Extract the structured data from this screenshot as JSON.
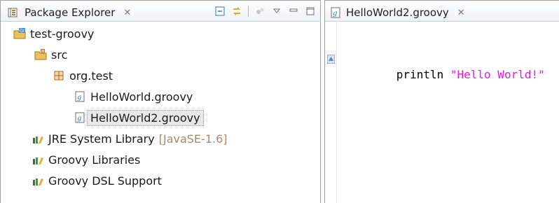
{
  "package_explorer": {
    "tab_title": "Package Explorer",
    "close_glyph": "✕",
    "toolbar": {
      "icons": [
        "collapse-all-icon",
        "link-with-editor-icon",
        "focus-icon",
        "view-menu-icon",
        "minimize-icon",
        "maximize-icon"
      ]
    },
    "tree": [
      {
        "label": "test-groovy",
        "icon": "groovy-project-icon",
        "level": 0
      },
      {
        "label": "src",
        "icon": "source-folder-icon",
        "level": 1
      },
      {
        "label": "org.test",
        "icon": "package-icon",
        "level": 2
      },
      {
        "label": "HelloWorld.groovy",
        "icon": "groovy-file-icon",
        "level": 3
      },
      {
        "label": "HelloWorld2.groovy",
        "icon": "groovy-file-icon",
        "level": 3,
        "selected": true
      },
      {
        "label": "JRE System Library",
        "decoration": "[JavaSE-1.6]",
        "icon": "library-icon",
        "level": 1
      },
      {
        "label": "Groovy Libraries",
        "icon": "library-icon",
        "level": 1
      },
      {
        "label": "Groovy DSL Support",
        "icon": "library-icon",
        "level": 1
      }
    ]
  },
  "editor": {
    "tab_title": "HelloWorld2.groovy",
    "close_glyph": "✕",
    "code": {
      "keyword": "println",
      "string": "\"Hello World!\""
    }
  },
  "colors": {
    "string": "#e01be0",
    "decoration": "#a8876a",
    "library": "#2f7a2f",
    "package": "#b0662a"
  }
}
